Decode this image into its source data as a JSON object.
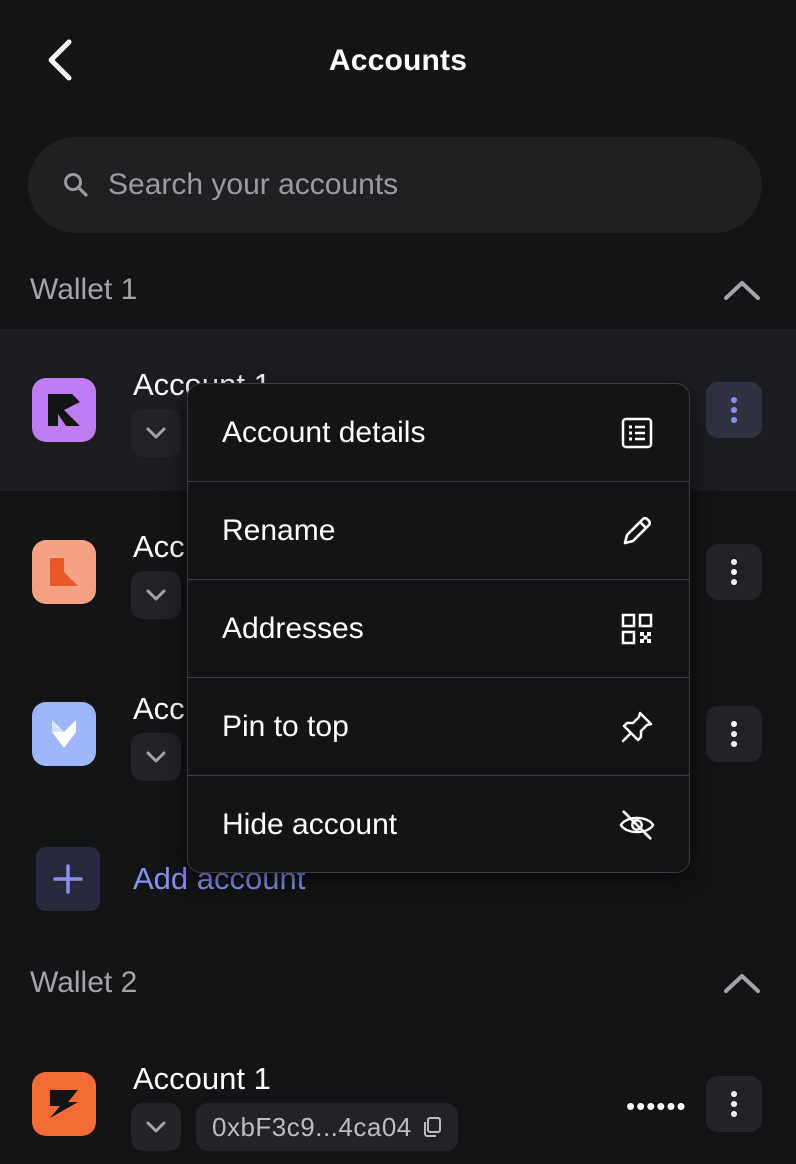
{
  "header": {
    "title": "Accounts"
  },
  "search": {
    "placeholder": "Search your accounts"
  },
  "wallets": [
    {
      "title": "Wallet 1",
      "accounts": [
        {
          "name": "Account 1",
          "avatar_color": "#c07cf2"
        },
        {
          "name": "Acc",
          "avatar_color": "#f4a283"
        },
        {
          "name": "Acc",
          "avatar_color": "#9eb7fa"
        }
      ],
      "add_account_label": "Add account"
    },
    {
      "title": "Wallet 2",
      "accounts": [
        {
          "name": "Account 1",
          "address": "0xbF3c9...4ca04",
          "balance_masked": "••••••",
          "avatar_color": "#f26a34"
        }
      ]
    }
  ],
  "context_menu": {
    "items": [
      {
        "label": "Account details",
        "icon": "list-details-icon"
      },
      {
        "label": "Rename",
        "icon": "pencil-icon"
      },
      {
        "label": "Addresses",
        "icon": "qr-code-icon"
      },
      {
        "label": "Pin to top",
        "icon": "pin-icon"
      },
      {
        "label": "Hide account",
        "icon": "eye-off-icon"
      }
    ]
  },
  "colors": {
    "background": "#131416",
    "surface": "#1f2022",
    "accent": "#8a8ff2",
    "muted_text": "#a3a4a9"
  }
}
